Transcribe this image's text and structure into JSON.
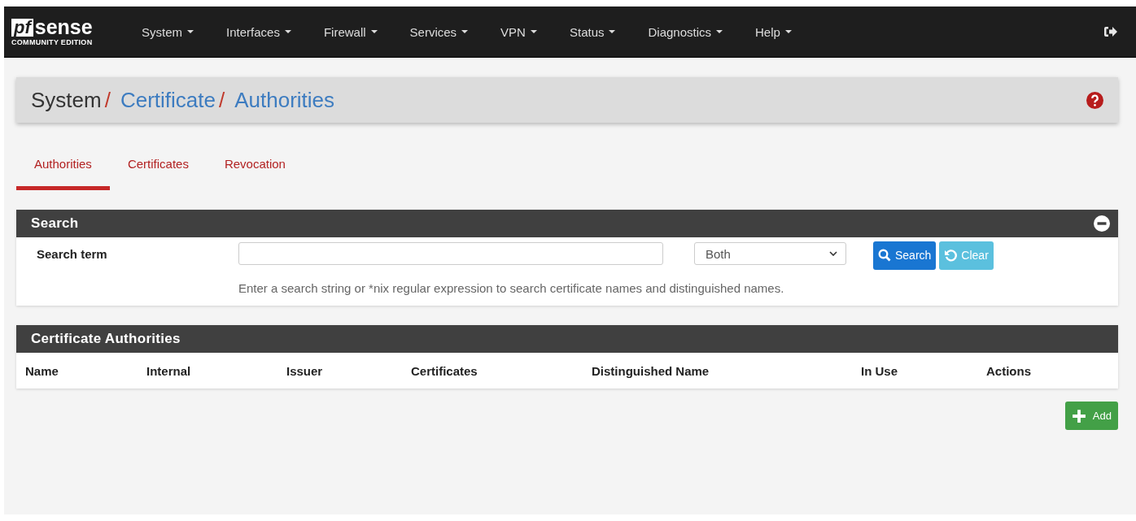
{
  "logo": {
    "mark": "pf",
    "word": "sense",
    "edition": "COMMUNITY EDITION"
  },
  "nav": [
    {
      "label": "System"
    },
    {
      "label": "Interfaces"
    },
    {
      "label": "Firewall"
    },
    {
      "label": "Services"
    },
    {
      "label": "VPN"
    },
    {
      "label": "Status"
    },
    {
      "label": "Diagnostics"
    },
    {
      "label": "Help"
    }
  ],
  "breadcrumb": [
    {
      "label": "System",
      "link": false
    },
    {
      "separator": "/",
      "label": "Certificate",
      "link": true
    },
    {
      "separator": "/",
      "label": "Authorities",
      "link": true
    }
  ],
  "tabs": [
    {
      "label": "Authorities",
      "selected": true
    },
    {
      "label": "Certificates",
      "selected": false
    },
    {
      "label": "Revocation",
      "selected": false
    }
  ],
  "search_panel": {
    "title": "Search",
    "label": "Search term",
    "select": "Both",
    "search_button": "Search",
    "clear_button": "Clear",
    "hint": "Enter a search string or *nix regular expression to search certificate names and distinguished names."
  },
  "table": {
    "title": "Certificate Authorities",
    "columns": [
      "Name",
      "Internal",
      "Issuer",
      "Certificates",
      "Distinguished Name",
      "In Use",
      "Actions"
    ]
  },
  "add_button": "Add"
}
